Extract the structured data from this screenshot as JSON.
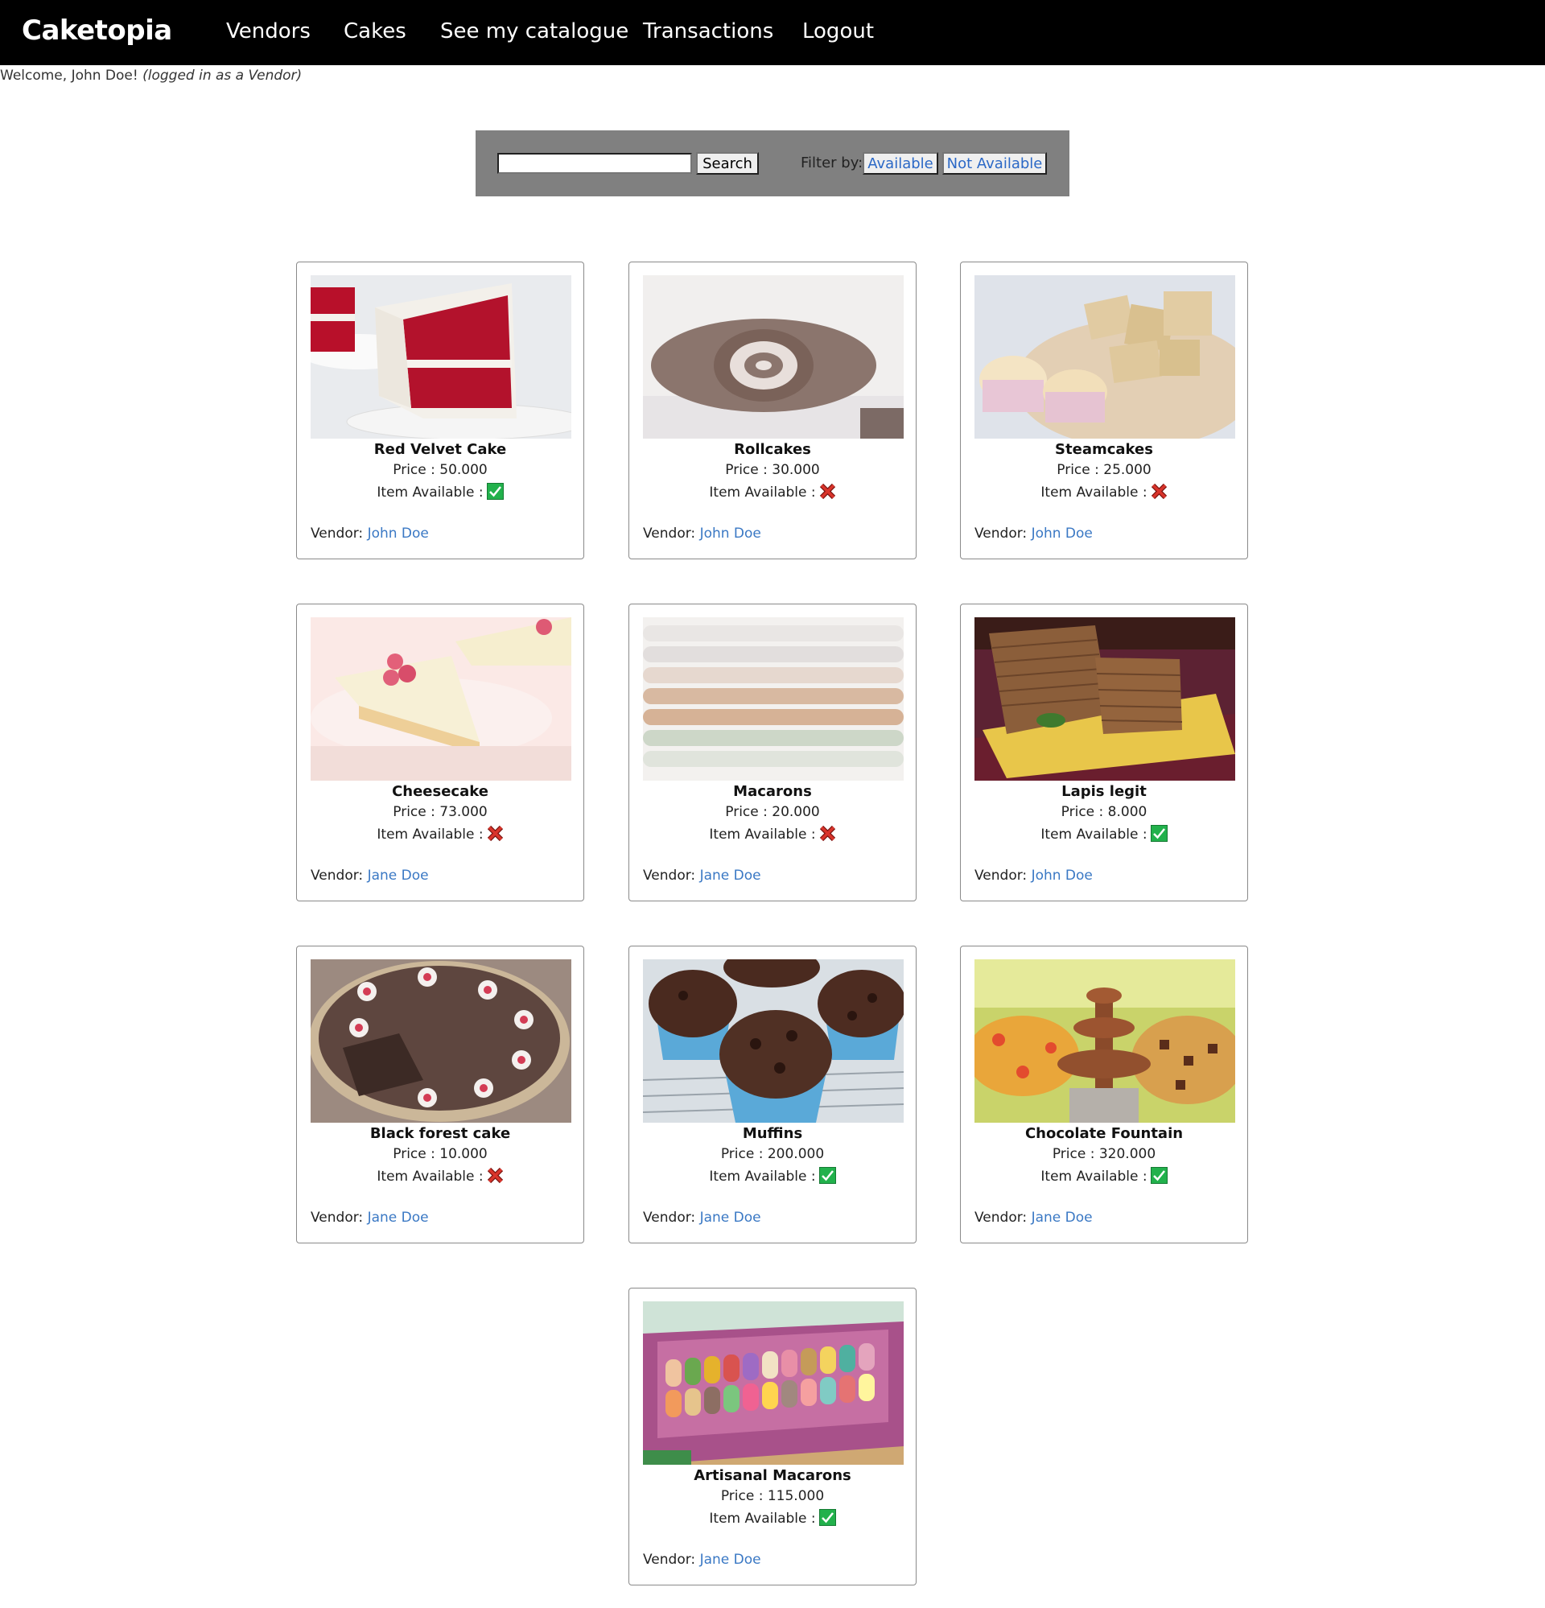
{
  "app": {
    "brand": "Caketopia"
  },
  "nav": {
    "items": [
      {
        "label": "Vendors"
      },
      {
        "label": "Cakes"
      },
      {
        "label": "See my catalogue"
      },
      {
        "label": "Transactions"
      },
      {
        "label": "Logout"
      }
    ]
  },
  "welcome": {
    "greeting": "Welcome, John Doe!",
    "role": "(logged in as a Vendor)"
  },
  "search": {
    "value": "",
    "button_label": "Search",
    "filter_label": "Filter by:",
    "filters": [
      {
        "label": "Available"
      },
      {
        "label": "Not Available"
      }
    ]
  },
  "colors": {
    "navbar_bg": "#000000",
    "panel_bg": "#808080",
    "link": "#3a78c4",
    "available_icon": "#22b14c",
    "unavailable_icon": "#d9342b"
  },
  "products": [
    {
      "name": "Red Velvet Cake",
      "price_label": "Price : 50.000",
      "availability_label": "Item Available :",
      "available": true,
      "availability_icon": "checkmark-icon",
      "vendor_label": "Vendor:",
      "vendor": "John Doe",
      "image": "red-velvet-cake-photo"
    },
    {
      "name": "Rollcakes",
      "price_label": "Price : 30.000",
      "availability_label": "Item Available :",
      "available": false,
      "availability_icon": "cross-icon",
      "vendor_label": "Vendor:",
      "vendor": "John Doe",
      "image": "rollcake-photo"
    },
    {
      "name": "Steamcakes",
      "price_label": "Price : 25.000",
      "availability_label": "Item Available :",
      "available": false,
      "availability_icon": "cross-icon",
      "vendor_label": "Vendor:",
      "vendor": "John Doe",
      "image": "steamcake-photo"
    },
    {
      "name": "Cheesecake",
      "price_label": "Price : 73.000",
      "availability_label": "Item Available :",
      "available": false,
      "availability_icon": "cross-icon",
      "vendor_label": "Vendor:",
      "vendor": "Jane Doe",
      "image": "cheesecake-photo"
    },
    {
      "name": "Macarons",
      "price_label": "Price : 20.000",
      "availability_label": "Item Available :",
      "available": false,
      "availability_icon": "cross-icon",
      "vendor_label": "Vendor:",
      "vendor": "Jane Doe",
      "image": "macarons-photo"
    },
    {
      "name": "Lapis legit",
      "price_label": "Price : 8.000",
      "availability_label": "Item Available :",
      "available": true,
      "availability_icon": "checkmark-icon",
      "vendor_label": "Vendor:",
      "vendor": "John Doe",
      "image": "lapis-legit-photo"
    },
    {
      "name": "Black forest cake",
      "price_label": "Price : 10.000",
      "availability_label": "Item Available :",
      "available": false,
      "availability_icon": "cross-icon",
      "vendor_label": "Vendor:",
      "vendor": "Jane Doe",
      "image": "black-forest-cake-photo"
    },
    {
      "name": "Muffins",
      "price_label": "Price : 200.000",
      "availability_label": "Item Available :",
      "available": true,
      "availability_icon": "checkmark-icon",
      "vendor_label": "Vendor:",
      "vendor": "Jane Doe",
      "image": "muffins-photo"
    },
    {
      "name": "Chocolate Fountain",
      "price_label": "Price : 320.000",
      "availability_label": "Item Available :",
      "available": true,
      "availability_icon": "checkmark-icon",
      "vendor_label": "Vendor:",
      "vendor": "Jane Doe",
      "image": "chocolate-fountain-photo"
    },
    {
      "name": "Artisanal Macarons",
      "price_label": "Price : 115.000",
      "availability_label": "Item Available :",
      "available": true,
      "availability_icon": "checkmark-icon",
      "vendor_label": "Vendor:",
      "vendor": "Jane Doe",
      "image": "artisanal-macarons-photo"
    }
  ]
}
